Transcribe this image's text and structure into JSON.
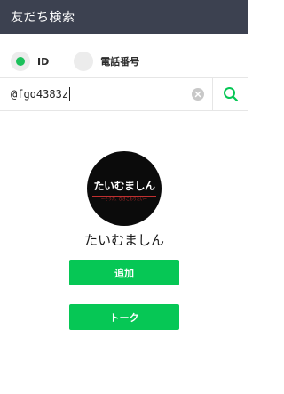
{
  "header": {
    "title": "友だち検索"
  },
  "search_type": {
    "options": [
      {
        "label": "ID",
        "selected": true
      },
      {
        "label": "電話番号",
        "selected": false
      }
    ]
  },
  "search": {
    "value": "@fgo4383z"
  },
  "result": {
    "avatar_logo_text": "たいむましん",
    "avatar_tagline": "〜そうだ、ひきこもりたい〜",
    "name": "たいむましん"
  },
  "actions": {
    "add_label": "追加",
    "talk_label": "トーク"
  },
  "colors": {
    "header_bg": "#3c4150",
    "accent_green": "#06c755"
  }
}
